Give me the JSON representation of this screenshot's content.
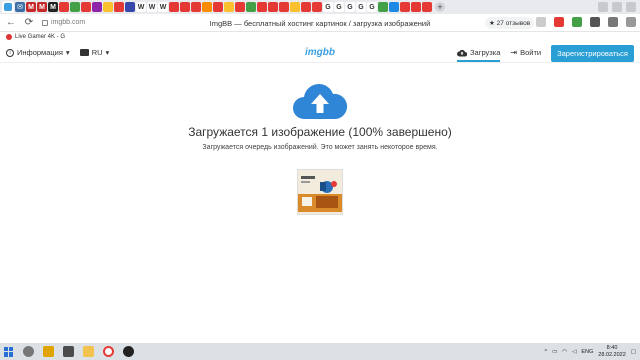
{
  "browser": {
    "url": "imgbb.com",
    "page_title": "ImgBB — бесплатный хостинг картинок / загрузка изображений",
    "reviews_label": "★ 27 отзывов",
    "tab_icons": [
      "ImgBB",
      "Mail",
      "M",
      "M",
      "M",
      "Multi",
      "Multi",
      "W",
      "W",
      "W",
      "W",
      "W",
      "W",
      "Yandex",
      "Yandex",
      "Yandex",
      "G",
      "G",
      "G",
      "G",
      "G",
      "G"
    ],
    "colors": {
      "tabstrip_bg": "#e8eaed",
      "accent": "#2a9fd6"
    }
  },
  "bookmarks": {
    "items": [
      "Live Gamer 4K - G"
    ]
  },
  "site": {
    "logo": "imgbb",
    "info_label": "Информация",
    "lang_label": "RU",
    "upload_label": "Загрузка",
    "login_label": "Войти",
    "register_label": "Зарегистрироваться"
  },
  "upload": {
    "heading": "Загружается 1 изображение (100% завершено)",
    "subheading": "Загружается очередь изображений. Это может занять некоторое время.",
    "progress_percent": 100
  },
  "taskbar": {
    "lang": "ENG",
    "time": "8:40",
    "date": "28.02.2022"
  }
}
